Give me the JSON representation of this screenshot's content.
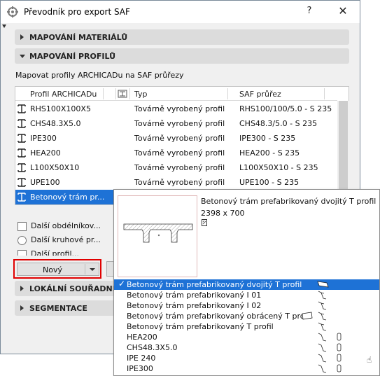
{
  "window": {
    "title": "Převodník pro export SAF",
    "help_label": "?",
    "close_label": "✕"
  },
  "sections": {
    "materials": "MAPOVÁNÍ MATERIÁLŮ",
    "profiles": "MAPOVÁNÍ PROFILŮ",
    "local_coords": "LOKÁLNÍ SOUŘADNICO",
    "segmentation": "SEGMENTACE"
  },
  "mapping": {
    "description": "Mapovat profily ARCHICADu na SAF průřezy",
    "columns": {
      "profile": "Profil ARCHICADu",
      "type": "Typ",
      "saf": "SAF průřez"
    },
    "rows": [
      {
        "profile": "RHS100X100X5",
        "type": "Továrně vyrobený profil",
        "saf": "RHS100/100/5.0 - S 235"
      },
      {
        "profile": "CHS48.3X5.0",
        "type": "Továrně vyrobený profil",
        "saf": "CHS48.3/5.0 - S 235"
      },
      {
        "profile": "IPE300",
        "type": "Továrně vyrobený profil",
        "saf": "IPE300 - S 235"
      },
      {
        "profile": "HEA200",
        "type": "Továrně vyrobený profil",
        "saf": "HEA200 - S 235"
      },
      {
        "profile": "L100X50X10",
        "type": "Továrně vyrobený profil",
        "saf": "L100X50X10 - S 235"
      },
      {
        "profile": "UPE100",
        "type": "Továrně vyrobený profil",
        "saf": "UPE100 - S 235"
      },
      {
        "profile": "Betonový trám pr...",
        "type": "",
        "saf": ""
      }
    ]
  },
  "options": {
    "other_rect": "Další obdélníkov...",
    "other_round": "Další kruhové pr...",
    "other_profile": "Další profil..."
  },
  "buttons": {
    "new_label": "Nový"
  },
  "popup": {
    "preview_name": "Betonový trám prefabrikovaný dvojitý T profil",
    "preview_dims": "2398 x 700",
    "items": [
      {
        "label": "Betonový trám prefabrikovaný dvojitý T profil",
        "icon": "double-t-icon",
        "selected": true
      },
      {
        "label": "Betonový trám prefabrikovaný I 01",
        "icon": "i-beam-icon",
        "selected": false
      },
      {
        "label": "Betonový trám prefabrikovaný I 02",
        "icon": "i-beam-icon",
        "selected": false
      },
      {
        "label": "Betonový trám prefabrikovaný obrácený T profil",
        "icon": "inverted-t-icon",
        "selected": false
      },
      {
        "label": "Betonový trám prefabrikovaný T profil",
        "icon": "t-beam-icon",
        "selected": false
      },
      {
        "label": "HEA200",
        "icon": "steel-profile-icon",
        "selected": false
      },
      {
        "label": "CHS48.3X5.0",
        "icon": "steel-profile-icon",
        "selected": false
      },
      {
        "label": "IPE 240",
        "icon": "steel-profile-icon",
        "selected": false
      },
      {
        "label": "IPE300",
        "icon": "steel-profile-icon",
        "selected": false
      }
    ]
  },
  "colors": {
    "selection": "#1e72d6",
    "highlight_border": "#e00000"
  }
}
